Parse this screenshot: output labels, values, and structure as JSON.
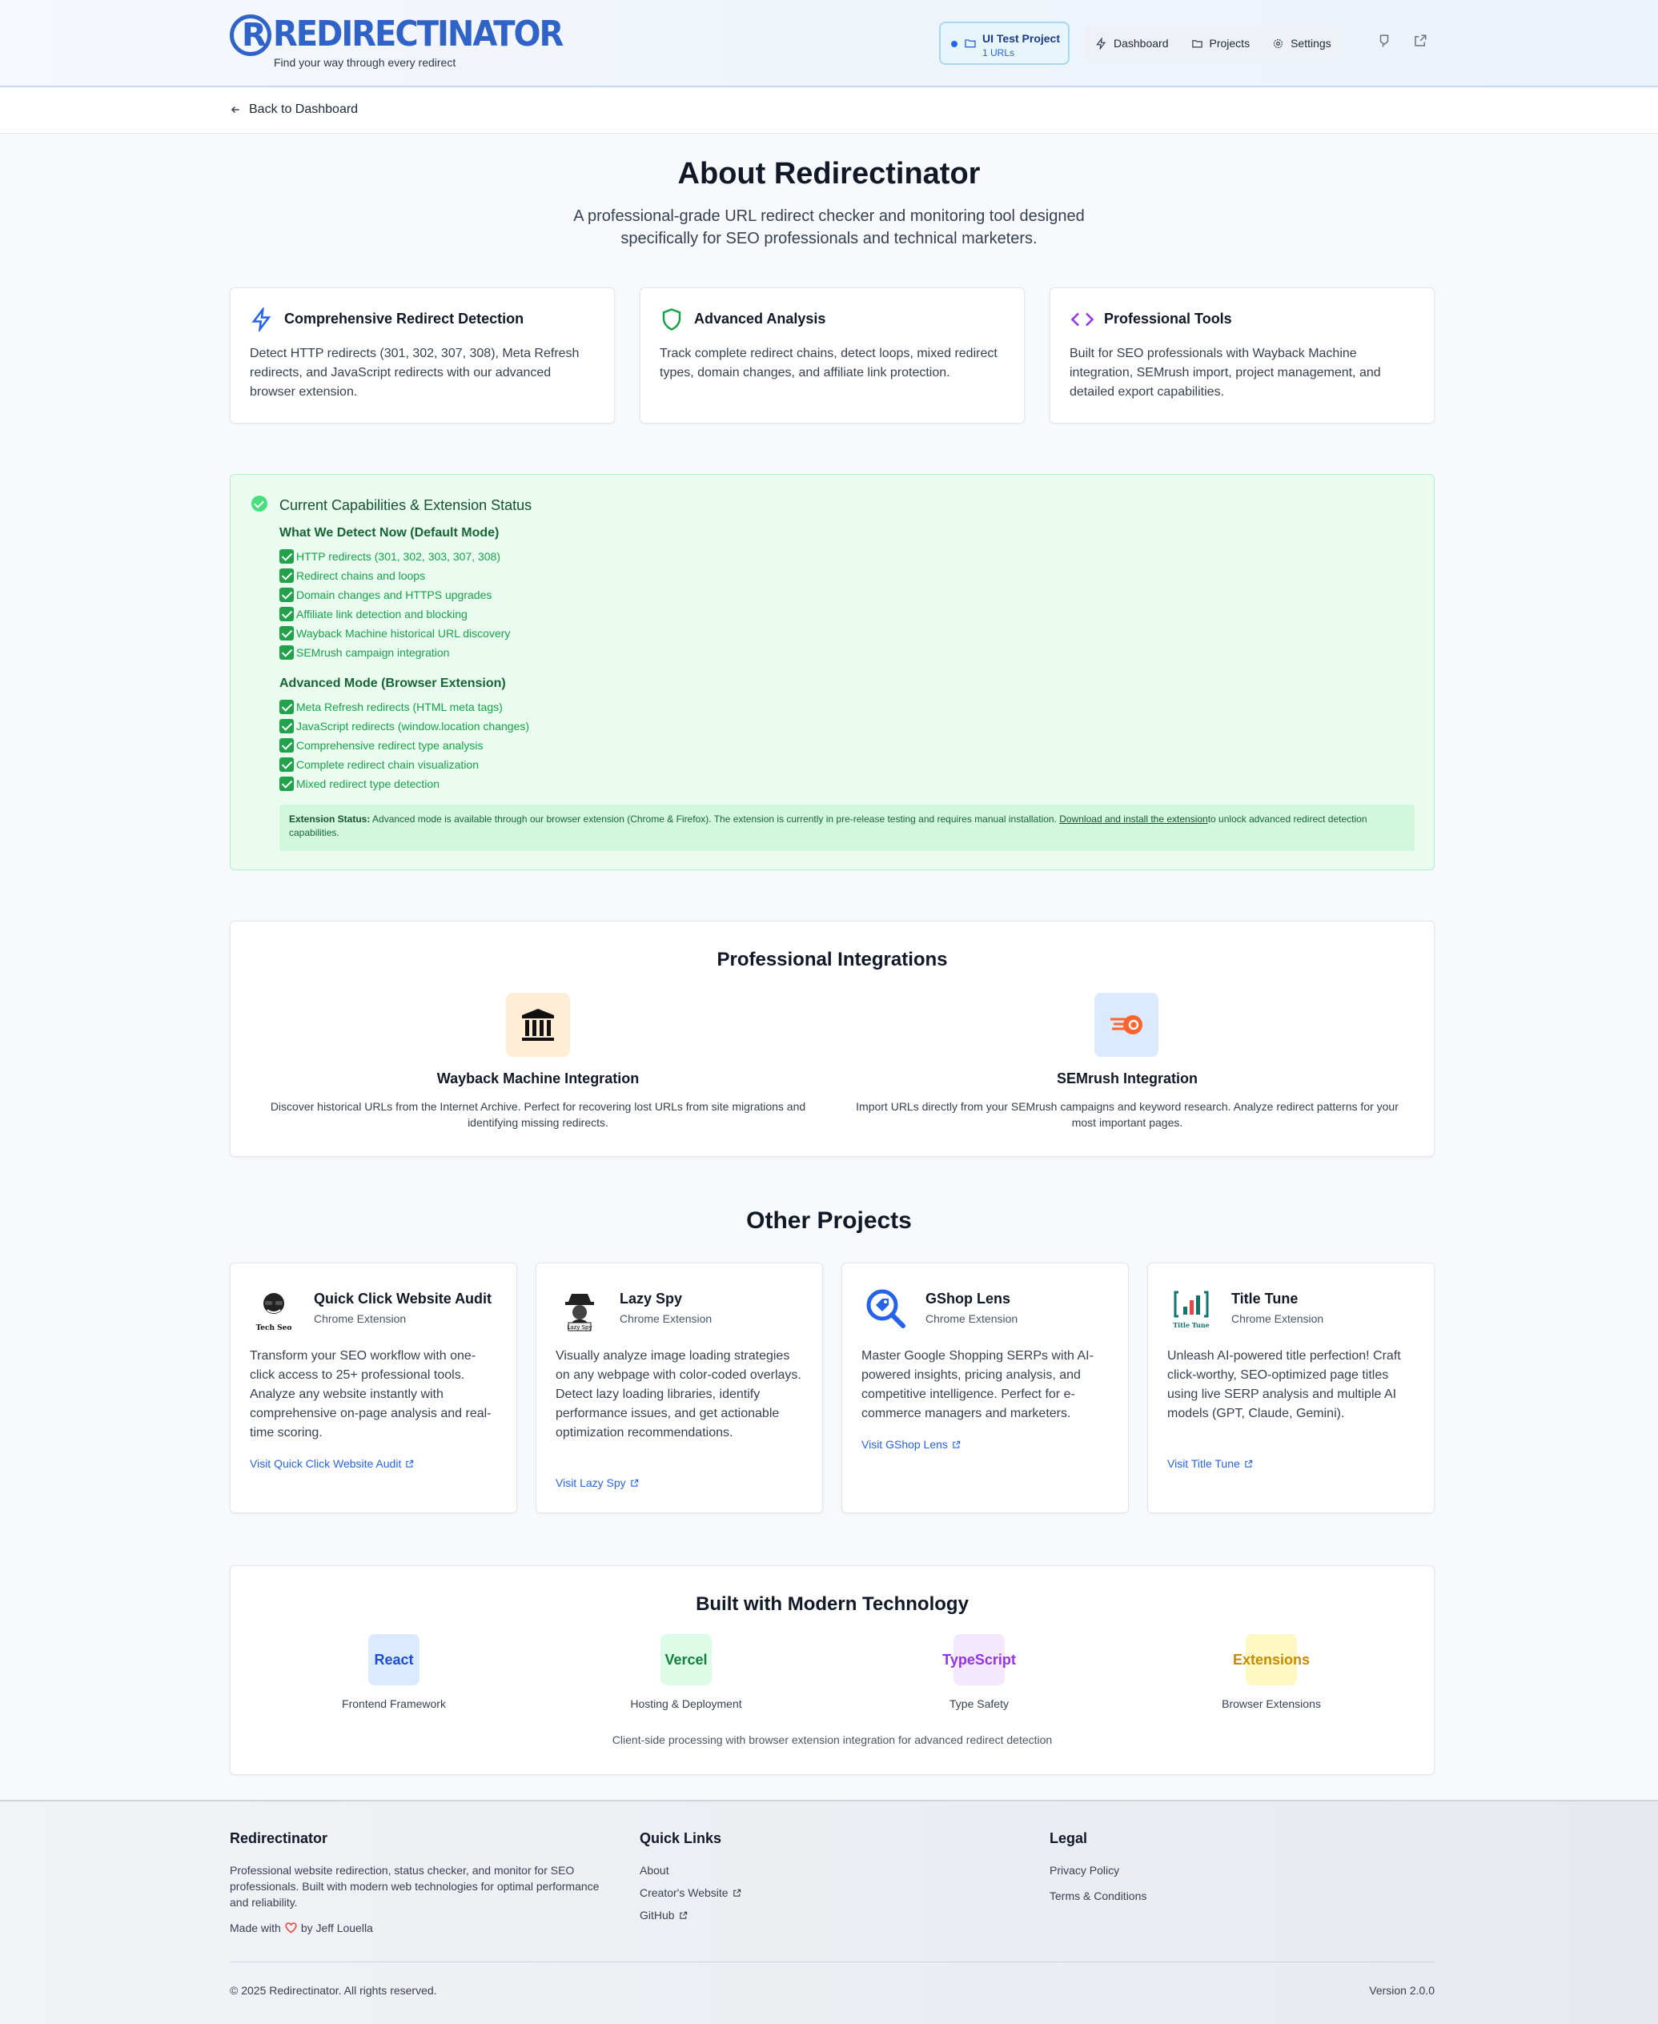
{
  "header": {
    "logo_text": "REDIRECTINATOR",
    "tagline": "Find your way through every redirect",
    "project": {
      "name": "UI Test Project",
      "count": "1 URLs"
    },
    "nav": [
      {
        "label": "Dashboard",
        "icon": "lightning-icon"
      },
      {
        "label": "Projects",
        "icon": "folder-icon"
      },
      {
        "label": "Settings",
        "icon": "gear-icon"
      }
    ]
  },
  "back_link": "Back to Dashboard",
  "hero": {
    "title": "About Redirectinator",
    "subtitle": "A professional-grade URL redirect checker and monitoring tool designed specifically for SEO professionals and technical marketers."
  },
  "features": [
    {
      "title": "Comprehensive Redirect Detection",
      "icon": "lightning-icon",
      "color": "#2563eb",
      "desc": "Detect HTTP redirects (301, 302, 307, 308), Meta Refresh redirects, and JavaScript redirects with our advanced browser extension."
    },
    {
      "title": "Advanced Analysis",
      "icon": "shield-icon",
      "color": "#16a34a",
      "desc": "Track complete redirect chains, detect loops, mixed redirect types, domain changes, and affiliate link protection."
    },
    {
      "title": "Professional Tools",
      "icon": "code-icon",
      "color": "#9333ea",
      "desc": "Built for SEO professionals with Wayback Machine integration, SEMrush import, project management, and detailed export capabilities."
    }
  ],
  "capabilities": {
    "title": "Current Capabilities & Extension Status",
    "default_heading": "What We Detect Now (Default Mode)",
    "default_items": [
      "HTTP redirects (301, 302, 303, 307, 308)",
      "Redirect chains and loops",
      "Domain changes and HTTPS upgrades",
      "Affiliate link detection and blocking",
      "Wayback Machine historical URL discovery",
      "SEMrush campaign integration"
    ],
    "advanced_heading": "Advanced Mode (Browser Extension)",
    "advanced_items": [
      "Meta Refresh redirects (HTML meta tags)",
      "JavaScript redirects (window.location changes)",
      "Comprehensive redirect type analysis",
      "Complete redirect chain visualization",
      "Mixed redirect type detection"
    ],
    "status_label": "Extension Status:",
    "status_text": " Advanced mode is available through our browser extension (Chrome & Firefox). The extension is currently in pre-release testing and requires manual installation. ",
    "status_link": "Download and install the extension",
    "status_tail": "to unlock advanced redirect detection capabilities."
  },
  "integrations": {
    "title": "Professional Integrations",
    "items": [
      {
        "title": "Wayback Machine Integration",
        "icon": "archive-building-icon",
        "desc": "Discover historical URLs from the Internet Archive. Perfect for recovering lost URLs from site migrations and identifying missing redirects."
      },
      {
        "title": "SEMrush Integration",
        "icon": "semrush-logo-icon",
        "desc": "Import URLs directly from your SEMrush campaigns and keyword research. Analyze redirect patterns for your most important pages."
      }
    ]
  },
  "projects": {
    "title": "Other Projects",
    "items": [
      {
        "name": "Quick Click Website Audit",
        "type": "Chrome Extension",
        "logo_caption": "Tech Seo",
        "desc": "Transform your SEO workflow with one-click access to 25+ professional tools. Analyze any website instantly with comprehensive on-page analysis and real-time scoring.",
        "link": "Visit Quick Click Website Audit"
      },
      {
        "name": "Lazy Spy",
        "type": "Chrome Extension",
        "logo_caption": "Lazy Spy",
        "desc": "Visually analyze image loading strategies on any webpage with color-coded overlays. Detect lazy loading libraries, identify performance issues, and get actionable optimization recommendations.",
        "link": "Visit Lazy Spy"
      },
      {
        "name": "GShop Lens",
        "type": "Chrome Extension",
        "logo_caption": "",
        "desc": "Master Google Shopping SERPs with AI-powered insights, pricing analysis, and competitive intelligence. Perfect for e-commerce managers and marketers.",
        "link": "Visit GShop Lens"
      },
      {
        "name": "Title Tune",
        "type": "Chrome Extension",
        "logo_caption": "Title Tune",
        "desc": "Unleash AI-powered title perfection! Craft click-worthy, SEO-optimized page titles using live SERP analysis and multiple AI models (GPT, Claude, Gemini).",
        "link": "Visit Title Tune"
      }
    ]
  },
  "tech": {
    "title": "Built with Modern Technology",
    "items": [
      {
        "name": "React",
        "label": "Frontend Framework",
        "fg": "#1d4ed8",
        "bg": "#dbeafe"
      },
      {
        "name": "Vercel",
        "label": "Hosting & Deployment",
        "fg": "#15803d",
        "bg": "#dcfce7"
      },
      {
        "name": "TypeScript",
        "label": "Type Safety",
        "fg": "#9333ea",
        "bg": "#f3e8ff"
      },
      {
        "name": "Extensions",
        "label": "Browser Extensions",
        "fg": "#ca8a04",
        "bg": "#fef9c3"
      }
    ],
    "note": "Client-side processing with browser extension integration for advanced redirect detection"
  },
  "footer": {
    "brand": "Redirectinator",
    "desc": "Professional website redirection, status checker, and monitor for SEO professionals. Built with modern web technologies for optimal performance and reliability.",
    "made_prefix": "Made with",
    "made_suffix": "by Jeff Louella",
    "quick_title": "Quick Links",
    "quick_links": [
      "About",
      "Creator's Website",
      "GitHub"
    ],
    "legal_title": "Legal",
    "legal_links": [
      "Privacy Policy",
      "Terms & Conditions"
    ],
    "copyright": "© 2025 Redirectinator. All rights reserved.",
    "version": "Version 2.0.0"
  }
}
